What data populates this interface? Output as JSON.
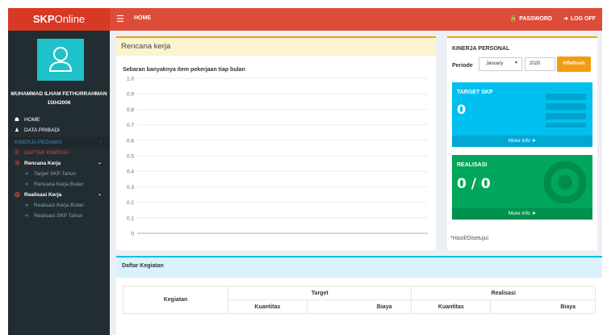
{
  "header": {
    "logo_bold": "SKP",
    "logo_rest": "Online",
    "menu_icon": "hamburger-icon",
    "home": "HOME",
    "password": "PASSWORD",
    "logoff": "LOG OFF"
  },
  "sidebar": {
    "user_name": "MUHAMMAD ILHAM FETHURRAHMAN",
    "user_id": "15042006",
    "items": [
      {
        "label": "HOME"
      },
      {
        "label": "DATA PRIBADI"
      },
      {
        "label": "KINERJA PEGAWAI"
      },
      {
        "label": "DAFTAR KINERJA"
      },
      {
        "label": "Rencana Kerja"
      },
      {
        "label": "Target SKP Tahun"
      },
      {
        "label": "Rencana Kerja Bulan"
      },
      {
        "label": "Realisasi Kerja"
      },
      {
        "label": "Realisasi Kerja Bulan"
      },
      {
        "label": "Realisasi SKP Tahun"
      }
    ]
  },
  "rencana": {
    "title": "Rencana kerja",
    "subtitle": "Sebaran banyaknya item pekerjaan tiap bulan"
  },
  "chart_data": {
    "type": "line",
    "title": "Sebaran banyaknya item pekerjaan tiap bulan",
    "xlabel": "",
    "ylabel": "",
    "ylim": [
      0,
      1.0
    ],
    "yticks": [
      "1.0",
      "0.9",
      "0.8",
      "0.7",
      "0.6",
      "0.5",
      "0.4",
      "0.3",
      "0.2",
      "0.1",
      "0"
    ],
    "series": [],
    "grid": true
  },
  "kinerja": {
    "title": "KINERJA PERSONAL",
    "periode_label": "Periode",
    "month": "January",
    "year": "2020",
    "refresh": "Refresh",
    "target_title": "TARGET SKP",
    "target_value": "0",
    "realisasi_title": "REALISASI",
    "realisasi_value": "0 / 0",
    "more_info": "More info",
    "note": "*Hasil/Disetujui"
  },
  "kegiatan": {
    "title": "Daftar Kegiatan",
    "col_kegiatan": "Kegiatan",
    "col_target": "Target",
    "col_realisasi": "Realisasi",
    "col_kuantitas": "Kuantitas",
    "col_biaya": "Biaya"
  },
  "colors": {
    "header_red": "#dd4b39",
    "logo_red": "#d73925",
    "sidebar_dark": "#222d32",
    "aqua": "#00c0ef",
    "green": "#00a65a",
    "orange": "#f39c12"
  }
}
